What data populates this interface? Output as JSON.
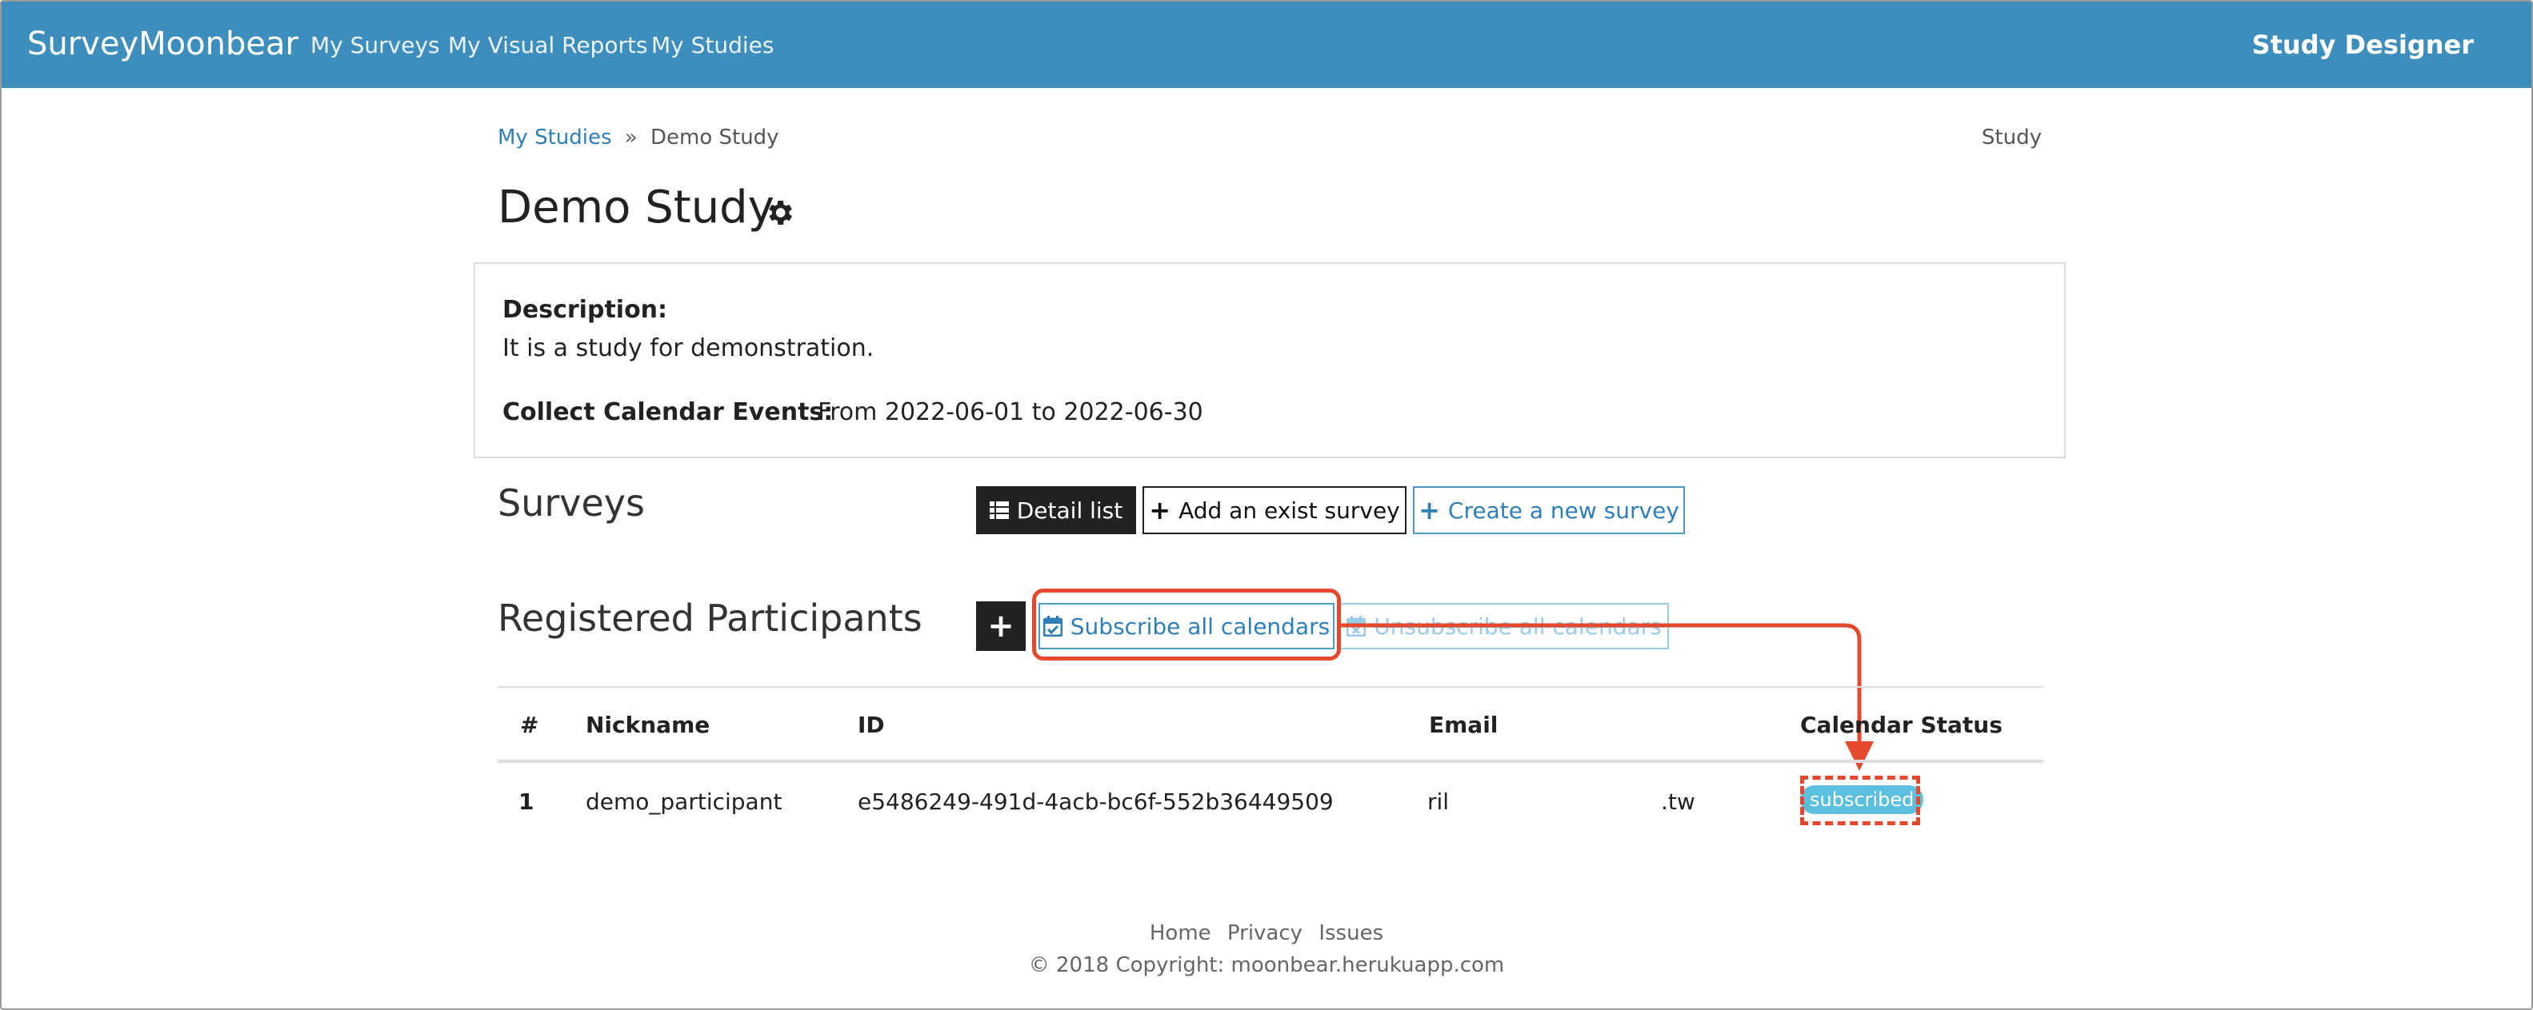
{
  "navbar": {
    "brand": "SurveyMoonbear",
    "links": [
      "My Surveys",
      "My Visual Reports",
      "My Studies"
    ],
    "right": "Study Designer"
  },
  "breadcrumb": {
    "parent": "My Studies",
    "separator": "»",
    "current": "Demo Study",
    "right_label": "Study"
  },
  "study": {
    "title": "Demo Study",
    "description_label": "Description:",
    "description": "It is a study for demonstration.",
    "calendar_label": "Collect Calendar Events:",
    "calendar_range": "From 2022-06-01 to 2022-06-30"
  },
  "surveys": {
    "title": "Surveys",
    "detail_list": "Detail list",
    "add_exist": "Add an exist survey",
    "create_new": "Create a new survey"
  },
  "participants": {
    "title": "Registered Participants",
    "add_symbol": "+",
    "subscribe_all": "Subscribe all calendars",
    "unsubscribe_all": "Unsubscribe all calendars",
    "columns": [
      "#",
      "Nickname",
      "ID",
      "Email",
      "Calendar Status"
    ],
    "rows": [
      {
        "num": "1",
        "nickname": "demo_participant",
        "id": "e5486249-491d-4acb-bc6f-552b36449509",
        "email_start": "ril",
        "email_end": ".tw",
        "status": "subscribed"
      }
    ]
  },
  "footer": {
    "links": [
      "Home",
      "Privacy",
      "Issues"
    ],
    "copyright": "© 2018 Copyright: moonbear.herukuapp.com"
  },
  "colors": {
    "navbar": "#3e8ebd",
    "accent": "#2f7fb6",
    "annotation": "#e5492d",
    "badge": "#5bc0de"
  }
}
